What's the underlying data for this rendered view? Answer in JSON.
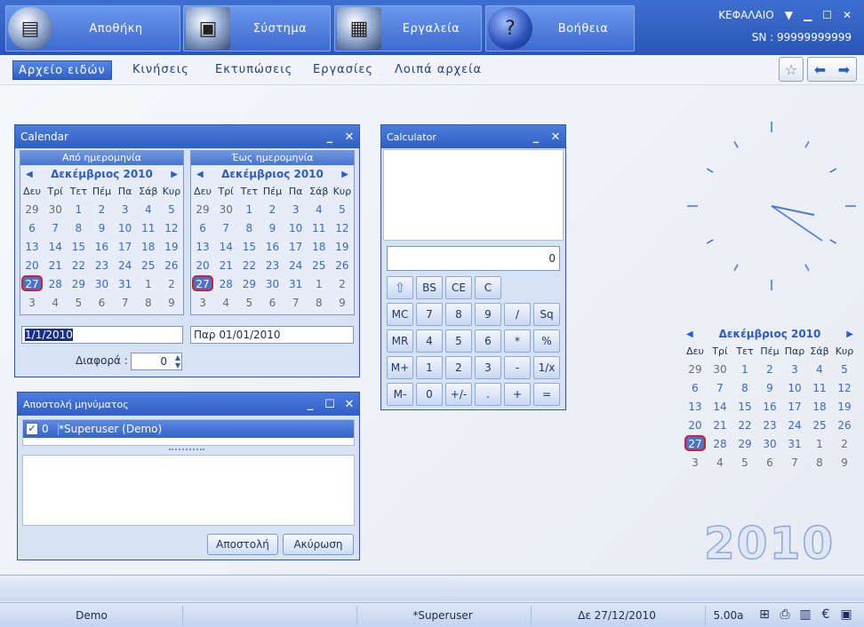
{
  "topbar": {
    "buttons": [
      {
        "label": "Αποθήκη",
        "icon": "warehouse-icon"
      },
      {
        "label": "Σύστημα",
        "icon": "system-icon"
      },
      {
        "label": "Εργαλεία",
        "icon": "calculator-icon"
      },
      {
        "label": "Βοήθεια",
        "icon": "help-icon"
      }
    ],
    "brand": "ΚΕΦΑΛΑΙΟ",
    "serial": "SN : 99999999999"
  },
  "menu": {
    "items": [
      "Αρχείο ειδών",
      "Κινήσεις",
      "Εκτυπώσεις",
      "Εργασίες",
      "Λοιπά αρχεία"
    ]
  },
  "calendar_window": {
    "title": "Calendar",
    "from_header": "Από ημερομηνία",
    "to_header": "Έως ημερομηνία",
    "month": "Δεκέμβριος 2010",
    "weekdays": [
      "Δευ",
      "Τρί",
      "Τετ",
      "Πέμ",
      "Πα",
      "Σάβ",
      "Κυρ"
    ],
    "from_value": "1/1/2010",
    "to_value": "Παρ 01/01/2010",
    "diff_label": "Διαφορά :",
    "diff_value": "0"
  },
  "calculator": {
    "title": "Calculator",
    "display": "0",
    "rows": [
      [
        "⇧",
        "BS",
        "CE",
        "C"
      ],
      [
        "MC",
        "7",
        "8",
        "9",
        "/",
        "Sq"
      ],
      [
        "MR",
        "4",
        "5",
        "6",
        "*",
        "%"
      ],
      [
        "M+",
        "1",
        "2",
        "3",
        "-",
        "1/x"
      ],
      [
        "M-",
        "0",
        "+/-",
        ".",
        "+",
        "="
      ]
    ]
  },
  "message_window": {
    "title": "Αποστολή μηνύματος",
    "row_num": "0",
    "row_user": "*Superuser (Demo)",
    "send": "Αποστολή",
    "cancel": "Ακύρωση"
  },
  "desk_calendar": {
    "month": "Δεκέμβριος 2010",
    "weekdays": [
      "Δευ",
      "Τρί",
      "Τετ",
      "Πέμ",
      "Παρ",
      "Σάβ",
      "Κυρ"
    ],
    "year": "2010"
  },
  "status": {
    "company": "Demo",
    "user": "*Superuser",
    "date": "Δε 27/12/2010",
    "version": "5.00a"
  },
  "colors": {
    "accent": "#2f5fc3",
    "today_ring": "#d0202a"
  }
}
